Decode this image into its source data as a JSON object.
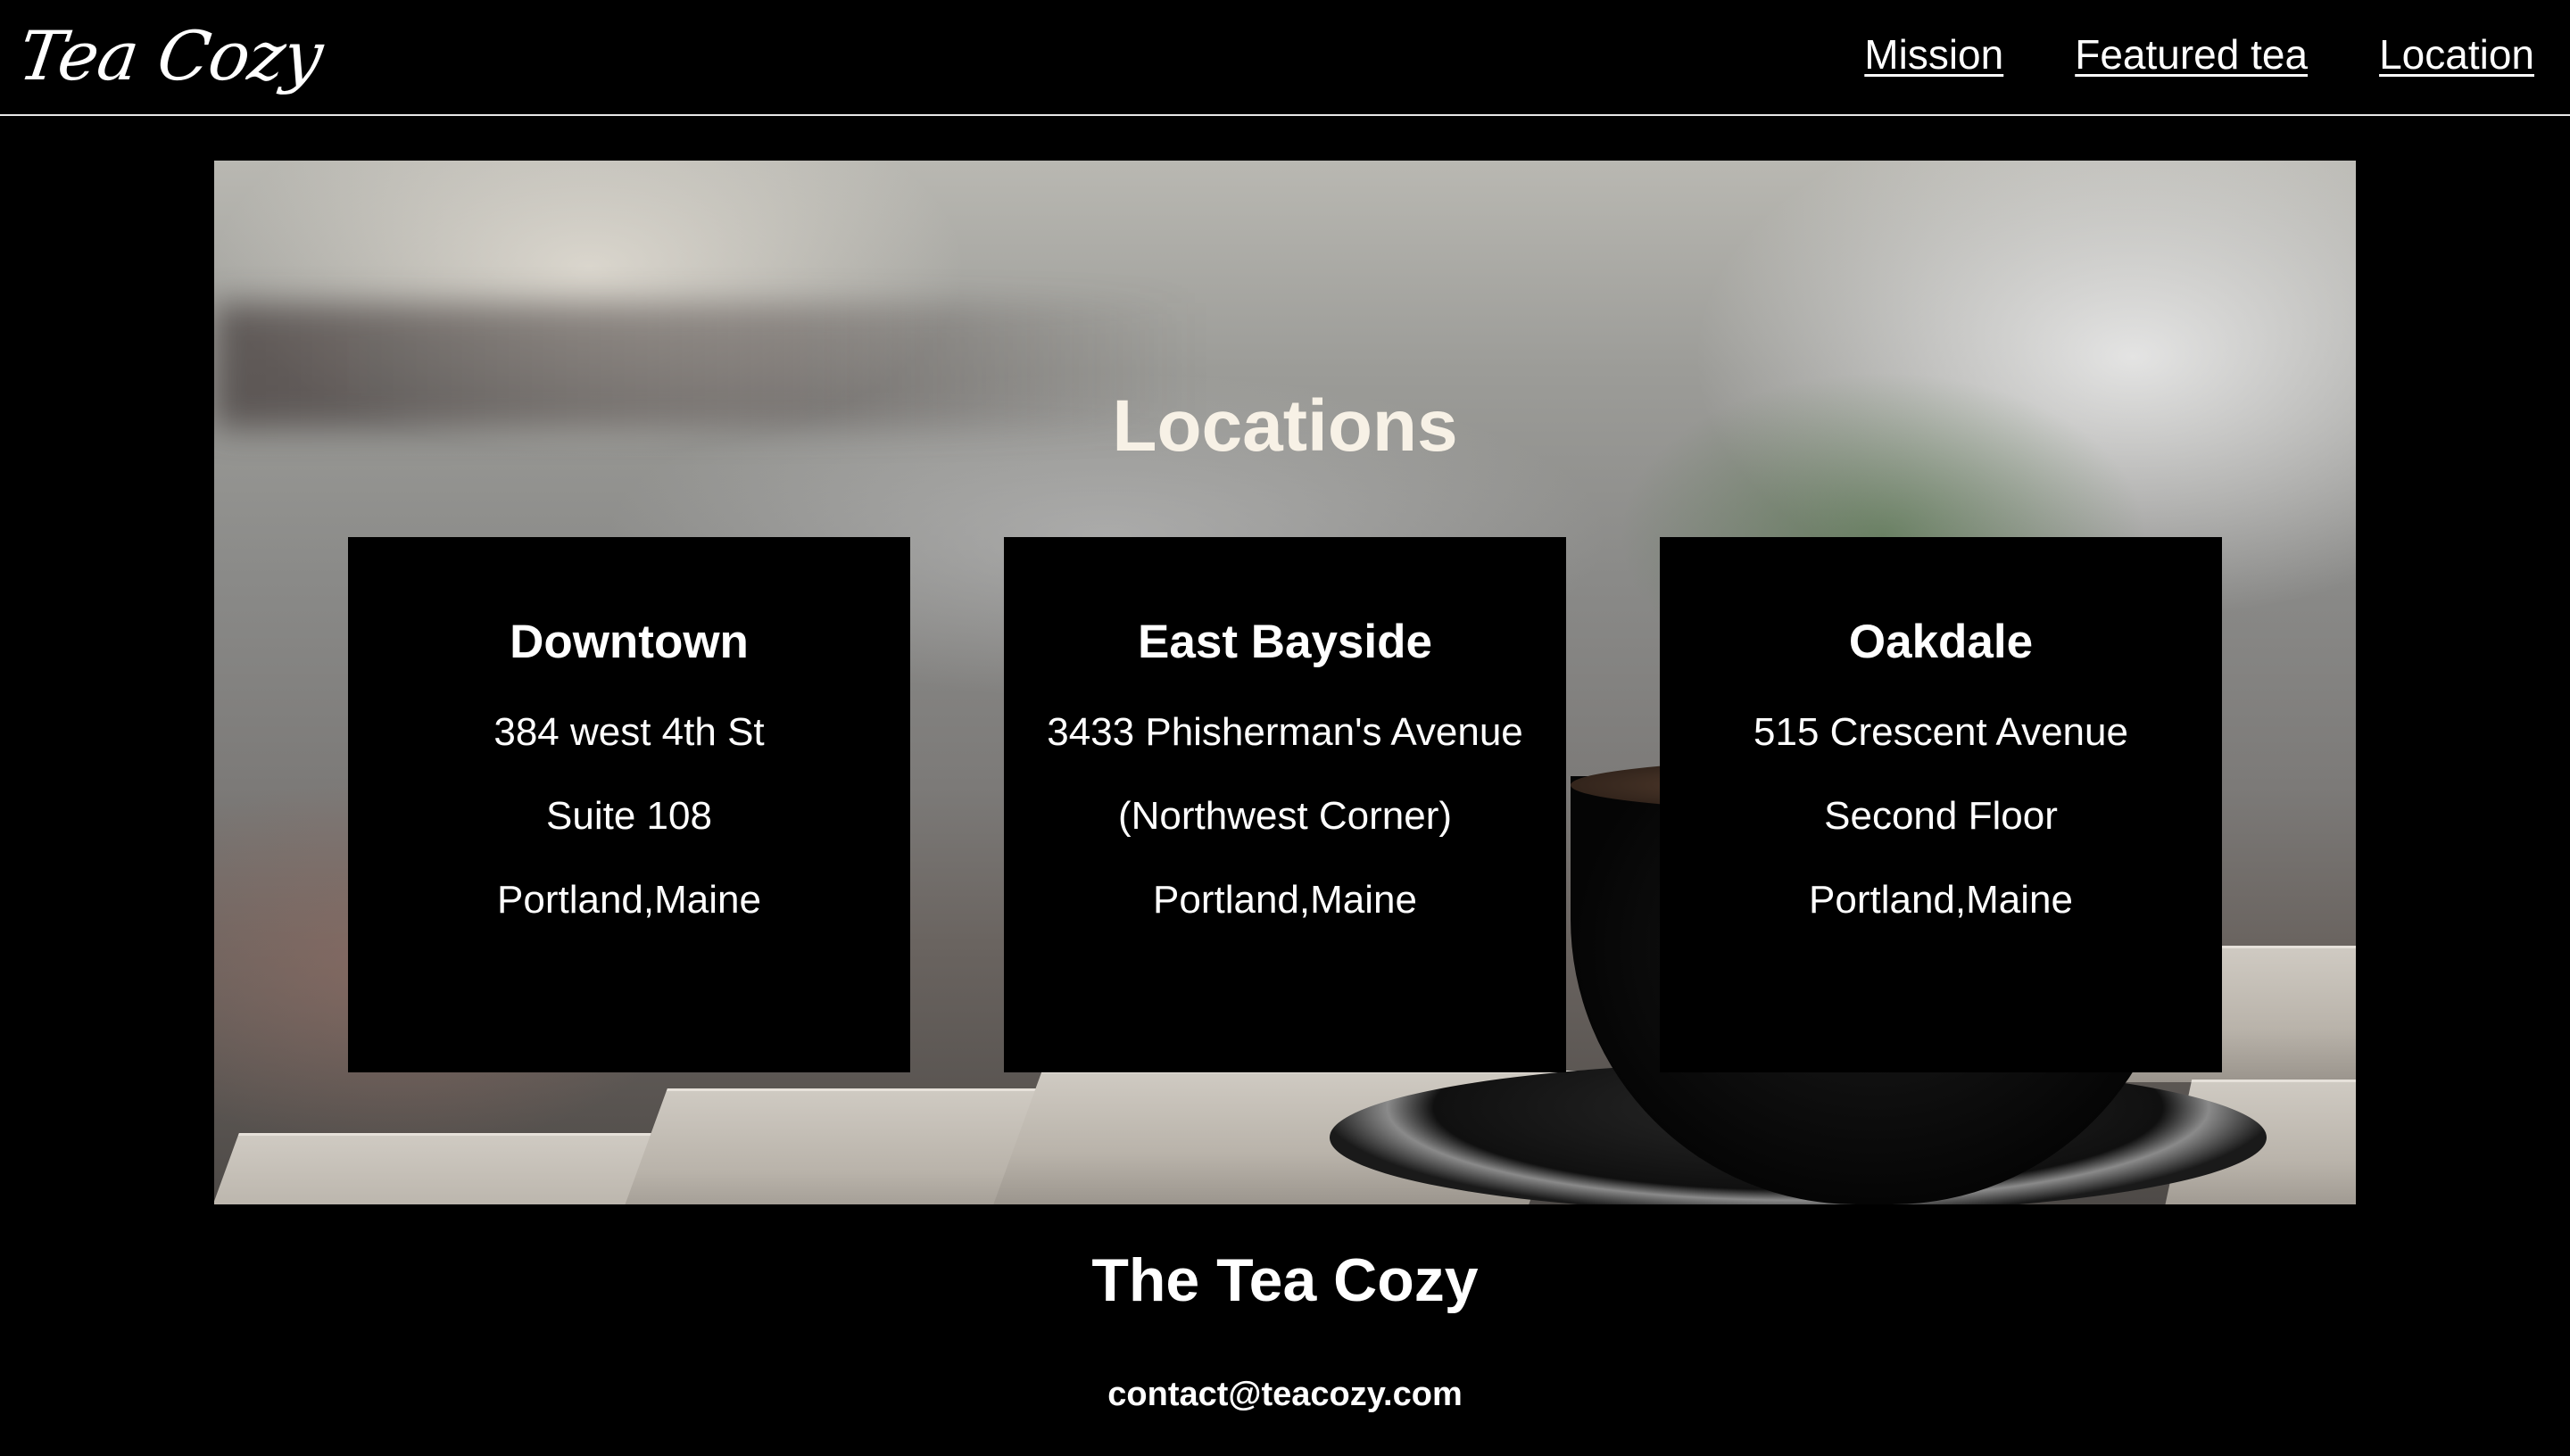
{
  "header": {
    "logo": "Tea Cozy",
    "nav": [
      {
        "label": "Mission"
      },
      {
        "label": "Featured tea"
      },
      {
        "label": "Location"
      }
    ]
  },
  "hero": {
    "title": "Locations",
    "locations": [
      {
        "name": "Downtown",
        "lines": [
          "384 west 4th St",
          "Suite 108",
          "Portland,Maine"
        ]
      },
      {
        "name": "East Bayside",
        "lines": [
          "3433 Phisherman's Avenue",
          "(Northwest Corner)",
          "Portland,Maine"
        ]
      },
      {
        "name": "Oakdale",
        "lines": [
          "515 Crescent Avenue",
          "Second Floor",
          "Portland,Maine"
        ]
      }
    ]
  },
  "footer": {
    "title": "The Tea Cozy",
    "email": "contact@teacozy.com"
  }
}
